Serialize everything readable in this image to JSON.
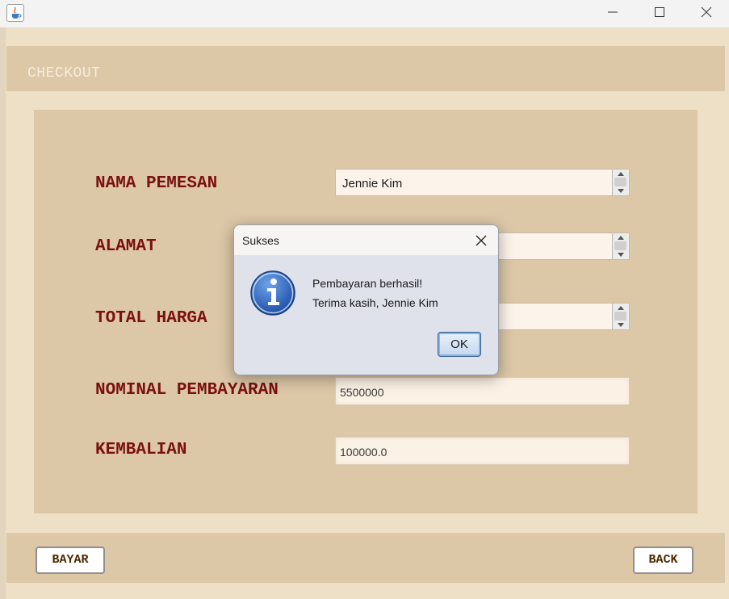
{
  "window": {
    "title": ""
  },
  "header": {
    "title": "CHECKOUT"
  },
  "form": {
    "nama_pemesan": {
      "label": "NAMA PEMESAN",
      "value": "Jennie Kim"
    },
    "alamat": {
      "label": "ALAMAT",
      "value": ""
    },
    "total_harga": {
      "label": "TOTAL HARGA",
      "value": ""
    },
    "nominal_pembayaran": {
      "label": "NOMINAL PEMBAYARAN",
      "value": "5500000"
    },
    "kembalian": {
      "label": "KEMBALIAN",
      "value": "100000.0"
    }
  },
  "footer": {
    "bayar_label": "BAYAR",
    "back_label": "BACK"
  },
  "dialog": {
    "title": "Sukses",
    "message_line1": "Pembayaran berhasil!",
    "message_line2": "Terima kasih, Jennie Kim",
    "ok_label": "OK",
    "icon": "information-icon"
  },
  "colors": {
    "panel": "#dcc7a7",
    "background": "#eedfc7",
    "label_text": "#7a1010",
    "button_text": "#4d2a00"
  }
}
